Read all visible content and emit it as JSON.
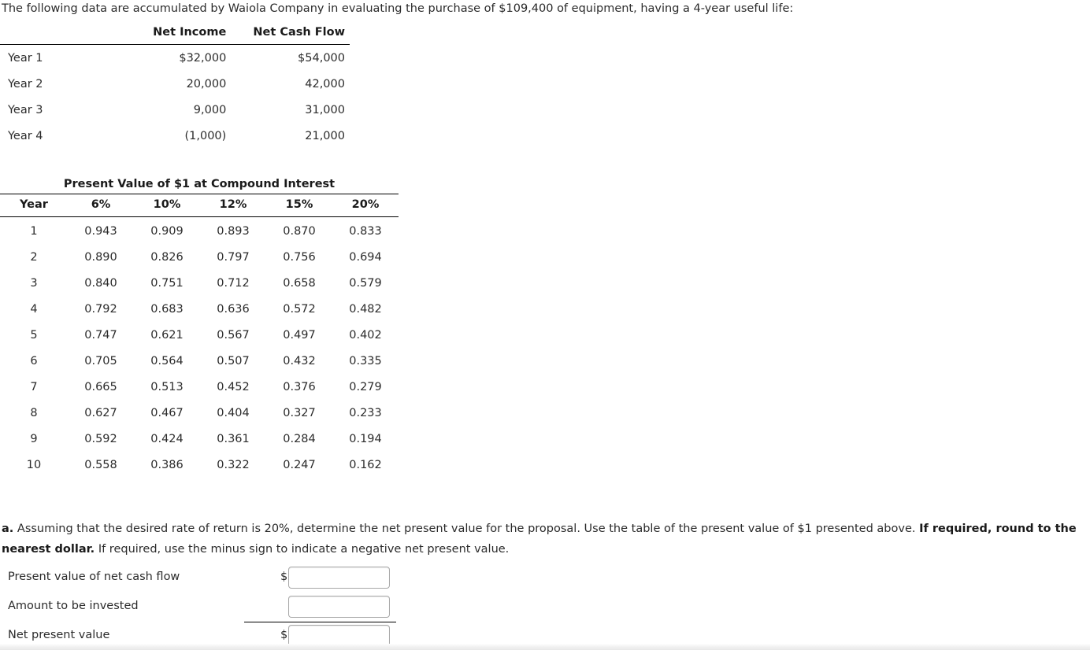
{
  "intro": {
    "text": "The following data are accumulated by Waiola Company in evaluating the purchase of $109,400 of equipment, having a 4-year useful life:"
  },
  "data_table": {
    "headers": [
      "",
      "Net Income",
      "Net Cash Flow"
    ],
    "rows": [
      {
        "label": "Year 1",
        "net_income": "$32,000",
        "net_cash_flow": "$54,000"
      },
      {
        "label": "Year 2",
        "net_income": "20,000",
        "net_cash_flow": "42,000"
      },
      {
        "label": "Year 3",
        "net_income": "9,000",
        "net_cash_flow": "31,000"
      },
      {
        "label": "Year 4",
        "net_income": "(1,000)",
        "net_cash_flow": "21,000"
      }
    ]
  },
  "pv_table": {
    "title": "Present Value of $1 at Compound Interest",
    "headers": [
      "Year",
      "6%",
      "10%",
      "12%",
      "15%",
      "20%"
    ],
    "rows": [
      {
        "year": "1",
        "r6": "0.943",
        "r10": "0.909",
        "r12": "0.893",
        "r15": "0.870",
        "r20": "0.833"
      },
      {
        "year": "2",
        "r6": "0.890",
        "r10": "0.826",
        "r12": "0.797",
        "r15": "0.756",
        "r20": "0.694"
      },
      {
        "year": "3",
        "r6": "0.840",
        "r10": "0.751",
        "r12": "0.712",
        "r15": "0.658",
        "r20": "0.579"
      },
      {
        "year": "4",
        "r6": "0.792",
        "r10": "0.683",
        "r12": "0.636",
        "r15": "0.572",
        "r20": "0.482"
      },
      {
        "year": "5",
        "r6": "0.747",
        "r10": "0.621",
        "r12": "0.567",
        "r15": "0.497",
        "r20": "0.402"
      },
      {
        "year": "6",
        "r6": "0.705",
        "r10": "0.564",
        "r12": "0.507",
        "r15": "0.432",
        "r20": "0.335"
      },
      {
        "year": "7",
        "r6": "0.665",
        "r10": "0.513",
        "r12": "0.452",
        "r15": "0.376",
        "r20": "0.279"
      },
      {
        "year": "8",
        "r6": "0.627",
        "r10": "0.467",
        "r12": "0.404",
        "r15": "0.327",
        "r20": "0.233"
      },
      {
        "year": "9",
        "r6": "0.592",
        "r10": "0.424",
        "r12": "0.361",
        "r15": "0.284",
        "r20": "0.194"
      },
      {
        "year": "10",
        "r6": "0.558",
        "r10": "0.386",
        "r12": "0.322",
        "r15": "0.247",
        "r20": "0.162"
      }
    ]
  },
  "question": {
    "marker": "a.",
    "part1": "Assuming that the desired rate of return is 20%, determine the net present value for the proposal. Use the table of the present value of $1 presented above.",
    "bold_part": "If required, round to the nearest dollar.",
    "part2": "If required, use the minus sign to indicate a negative net present value."
  },
  "answers": {
    "rows": [
      {
        "label": "Present value of net cash flow",
        "dollar": "$",
        "value": "",
        "placeholder": ""
      },
      {
        "label": "Amount to be invested",
        "dollar": "",
        "value": "",
        "placeholder": ""
      },
      {
        "label": "Net present value",
        "dollar": "$",
        "value": "",
        "placeholder": ""
      }
    ]
  },
  "colors": {
    "text": "#2b2b2b",
    "heading": "#1a1a1a",
    "rule": "#000000",
    "input_border": "#a8a8a8",
    "background": "#ffffff"
  }
}
